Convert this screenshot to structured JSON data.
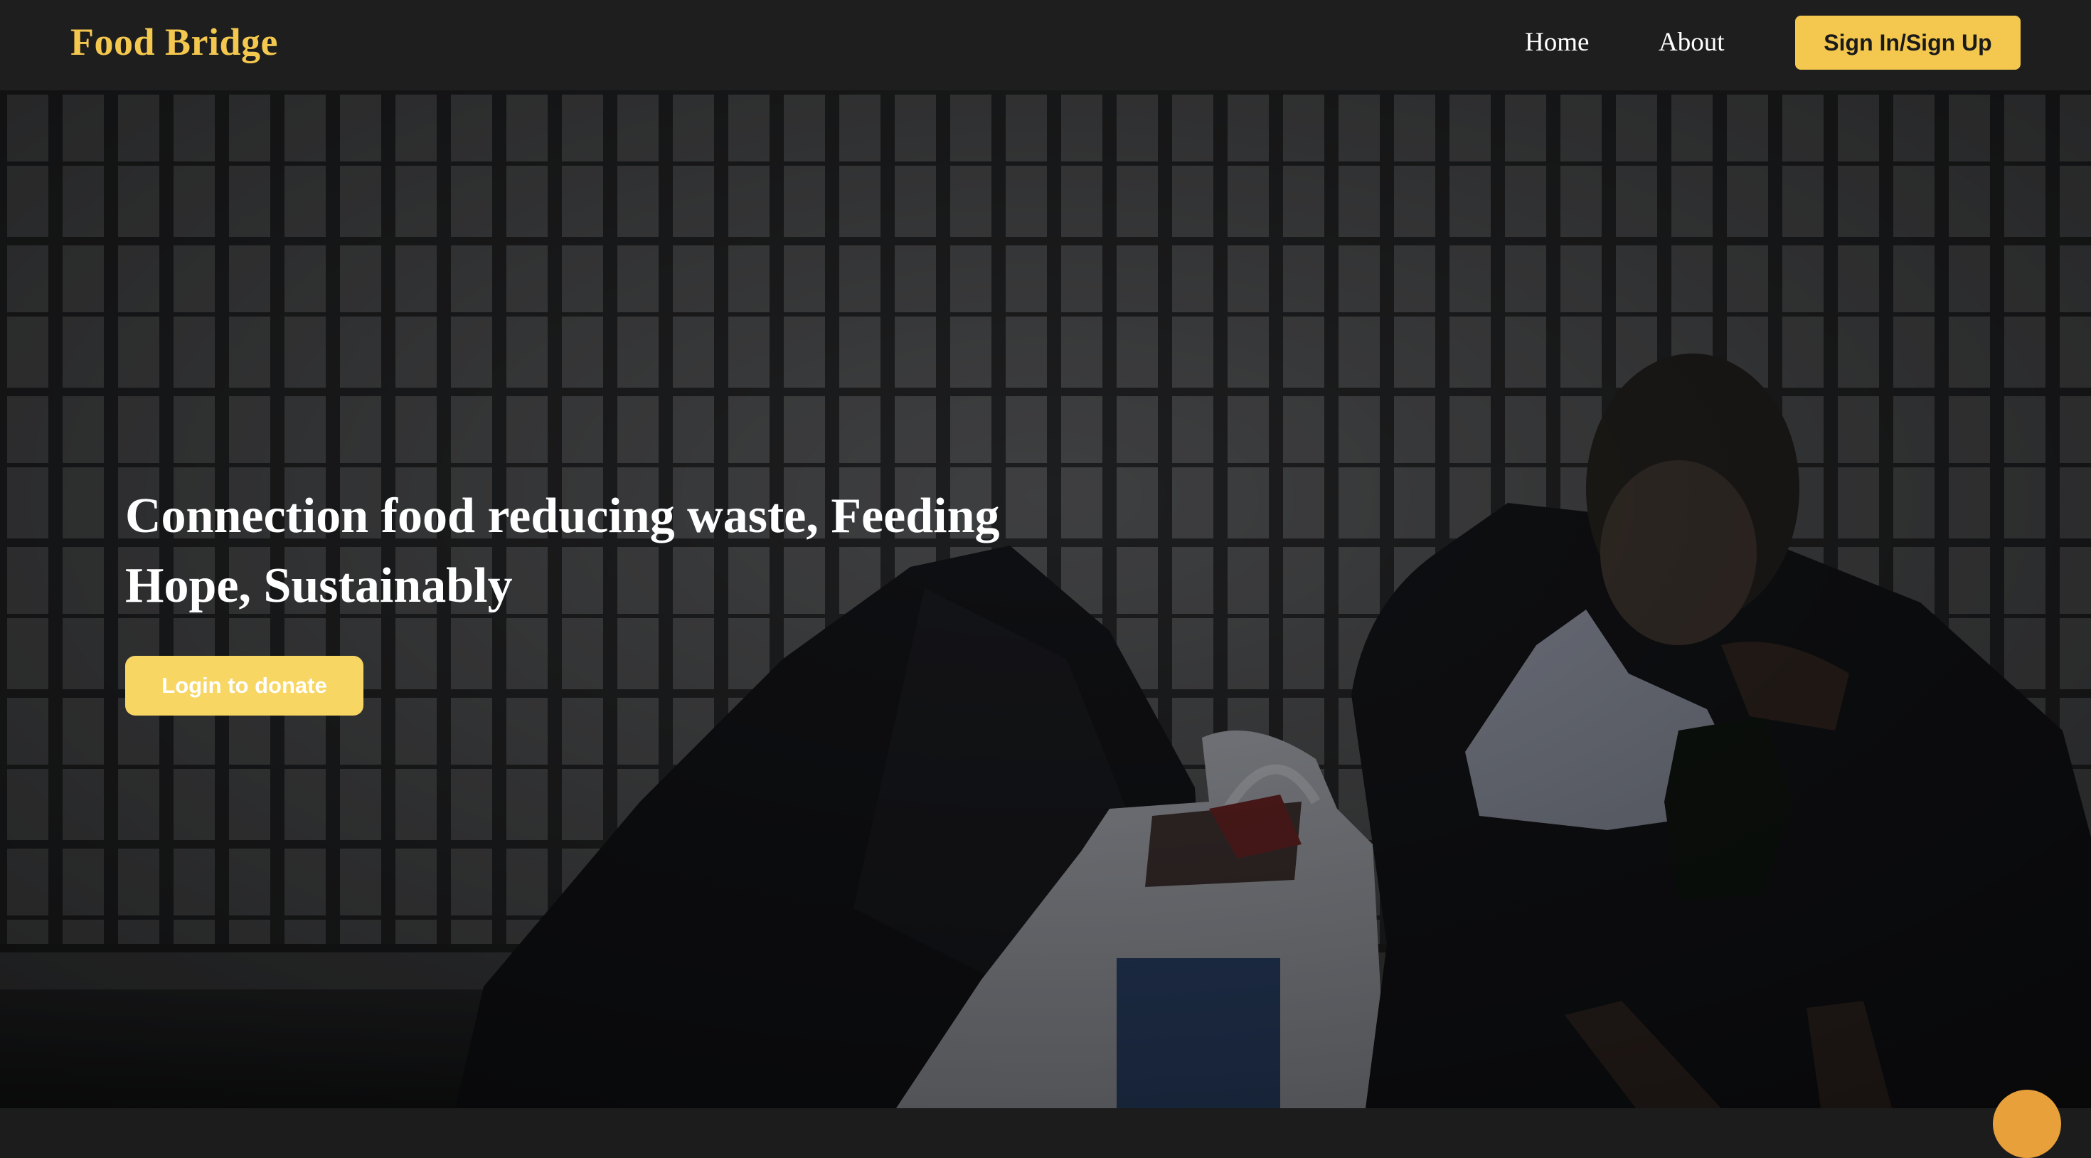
{
  "navbar": {
    "brand": "Food Bridge",
    "links": [
      {
        "label": "Home"
      },
      {
        "label": "About"
      }
    ],
    "signin_label": "Sign In/Sign Up"
  },
  "hero": {
    "title": "Connection food reducing waste, Feeding Hope, Sustainably",
    "cta_label": "Login to donate",
    "image": "photo of a person sitting against a brick wall eating from a plastic bag"
  },
  "colors": {
    "brand_yellow": "#f4c84e",
    "navbar_bg": "#1e1e1e",
    "cta_yellow": "#f7d664",
    "fab_orange": "#e8a03a"
  },
  "icons": {
    "floating_action": "chat-bubble-icon"
  }
}
